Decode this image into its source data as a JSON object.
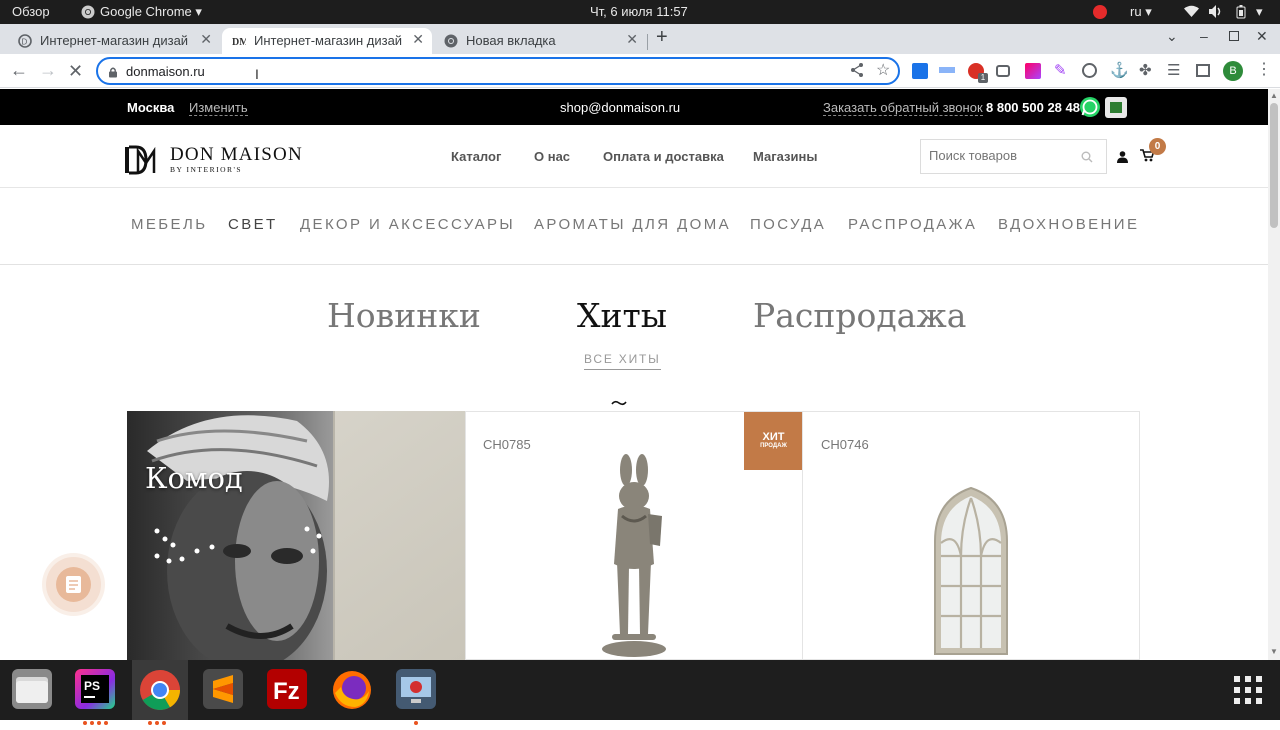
{
  "system_bar": {
    "overview": "Обзор",
    "app_name": "Google Chrome",
    "datetime": "Чт, 6 июля  11:57",
    "language": "ru"
  },
  "browser": {
    "tabs": [
      {
        "label": "Интернет-магазин дизай",
        "active": false
      },
      {
        "label": "Интернет-магазин дизай",
        "active": true
      },
      {
        "label": "Новая вкладка",
        "active": false
      }
    ],
    "address": "donmaison.ru",
    "profile_initial": "B",
    "extension_badge": "1"
  },
  "site": {
    "topbar": {
      "city": "Москва",
      "change_label": "Изменить",
      "email": "shop@donmaison.ru",
      "callback_label": "Заказать обратный звонок",
      "phone": "8 800 500 28 48"
    },
    "logo": {
      "name": "DON MAISON",
      "tagline": "BY INTERIOR'S"
    },
    "menu": [
      "Каталог",
      "О нас",
      "Оплата и доставка",
      "Магазины"
    ],
    "search_placeholder": "Поиск товаров",
    "cart_count": "0",
    "categories": [
      "МЕБЕЛЬ",
      "СВЕТ",
      "ДЕКОР И АКСЕССУАРЫ",
      "АРОМАТЫ ДЛЯ ДОМА",
      "ПОСУДА",
      "РАСПРОДАЖА",
      "ВДОХНОВЕНИЕ"
    ],
    "showcase_tabs": [
      "Новинки",
      "Хиты",
      "Распродажа"
    ],
    "active_showcase_tab": "Хиты",
    "all_link": "ВСЕ ХИТЫ",
    "banner_title": "Комод",
    "products": [
      {
        "sku": "CH0785",
        "badge_main": "ХИТ",
        "badge_sub": "ПРОДАЖ"
      },
      {
        "sku": "CH0746"
      }
    ]
  },
  "colors": {
    "accent": "#c27a47",
    "chrome_blue": "#1a73e8",
    "whatsapp": "#25d366"
  }
}
